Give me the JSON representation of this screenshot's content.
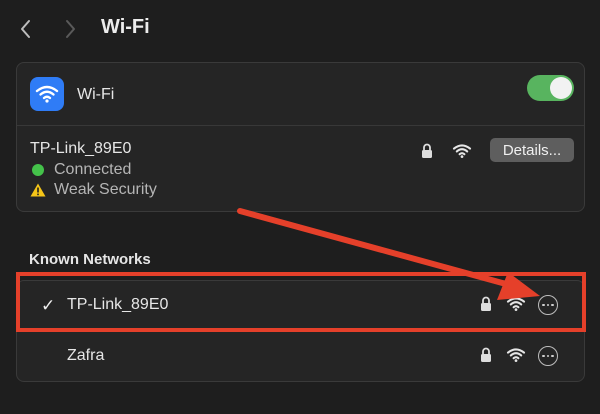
{
  "header": {
    "title": "Wi-Fi",
    "back_icon": "chevron-left-icon",
    "forward_icon": "chevron-right-icon"
  },
  "wifi_panel": {
    "label": "Wi-Fi",
    "icon": "wifi-icon",
    "toggle_on": true,
    "current_network": {
      "name": "TP-Link_89E0",
      "status": "Connected",
      "security_warning": "Weak Security",
      "details_label": "Details..."
    }
  },
  "known_networks": {
    "title": "Known Networks",
    "items": [
      {
        "name": "TP-Link_89E0",
        "checkmark": "✓",
        "connected": true
      },
      {
        "name": "Zafra",
        "checkmark": "",
        "connected": false
      }
    ]
  },
  "colors": {
    "accent_blue": "#2f7cf6",
    "toggle_green": "#58b45f",
    "annotation_red": "#e5402a",
    "status_green": "#44c24a",
    "warning_yellow": "#f5c518"
  }
}
